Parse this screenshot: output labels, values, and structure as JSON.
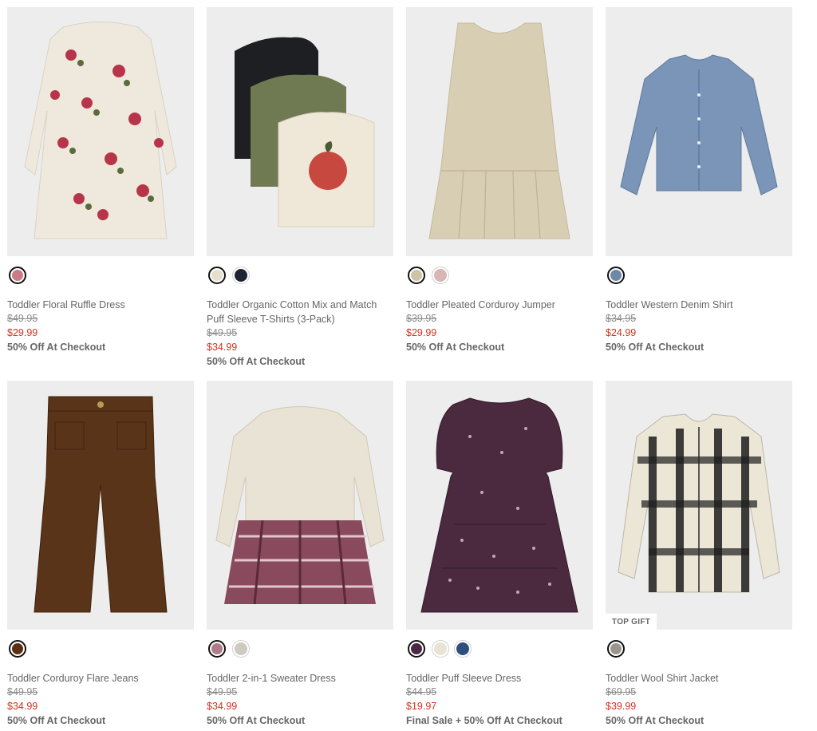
{
  "colors": {
    "sale": "#d0341f",
    "tile_bg": "#ededed"
  },
  "products": [
    {
      "name": "Toddler Floral Ruffle Dress",
      "original_price": "$49.95",
      "sale_price": "$29.99",
      "promo": "50% Off At Checkout",
      "swatches": [
        {
          "color": "#c97c86",
          "selected": true
        }
      ]
    },
    {
      "name": "Toddler Organic Cotton Mix and Match Puff Sleeve T-Shirts (3-Pack)",
      "original_price": "$49.95",
      "sale_price": "$34.99",
      "promo": "50% Off At Checkout",
      "swatches": [
        {
          "color": "#e6dfcc",
          "selected": true
        },
        {
          "color": "#1f2433",
          "selected": false
        }
      ]
    },
    {
      "name": "Toddler Pleated Corduroy Jumper",
      "original_price": "$39.95",
      "sale_price": "$29.99",
      "promo": "50% Off At Checkout",
      "swatches": [
        {
          "color": "#cfc3a6",
          "selected": true
        },
        {
          "color": "#d8b6b3",
          "selected": false
        }
      ]
    },
    {
      "name": "Toddler Western Denim Shirt",
      "original_price": "$34.95",
      "sale_price": "$24.99",
      "promo": "50% Off At Checkout",
      "swatches": [
        {
          "color": "#6f88a8",
          "selected": true
        }
      ]
    },
    {
      "name": "Toddler Corduroy Flare Jeans",
      "original_price": "$49.95",
      "sale_price": "$34.99",
      "promo": "50% Off At Checkout",
      "swatches": [
        {
          "color": "#5a2f14",
          "selected": true
        }
      ]
    },
    {
      "name": "Toddler 2-in-1 Sweater Dress",
      "original_price": "$49.95",
      "sale_price": "$34.99",
      "promo": "50% Off At Checkout",
      "swatches": [
        {
          "color": "#b07c8c",
          "selected": true
        },
        {
          "color": "#cfcac0",
          "selected": false
        }
      ]
    },
    {
      "name": "Toddler Puff Sleeve Dress",
      "original_price": "$44.95",
      "sale_price": "$19.97",
      "promo": "Final Sale + 50% Off At Checkout",
      "swatches": [
        {
          "color": "#4a2a42",
          "selected": true
        },
        {
          "color": "#e9e3d4",
          "selected": false
        },
        {
          "color": "#2e4f7c",
          "selected": false
        }
      ]
    },
    {
      "name": "Toddler Wool Shirt Jacket",
      "original_price": "$69.95",
      "sale_price": "$39.99",
      "promo": "50% Off At Checkout",
      "badge": "TOP GIFT",
      "swatches": [
        {
          "color": "#9a968c",
          "selected": true
        }
      ]
    }
  ]
}
